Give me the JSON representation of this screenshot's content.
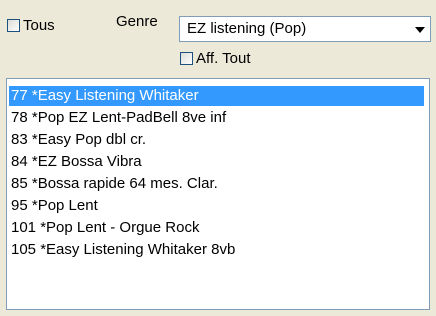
{
  "filter": {
    "tous_label": "Tous",
    "tous_checked": false,
    "genre_label": "Genre",
    "genre_value": "EZ listening (Pop)",
    "aff_tout_label": "Aff. Tout",
    "aff_tout_checked": false
  },
  "styles": {
    "selected_index": 0,
    "items": [
      "77 *Easy Listening Whitaker",
      "78 *Pop EZ Lent-PadBell 8ve inf",
      "83 *Easy Pop dbl cr.",
      "84 *EZ Bossa Vibra",
      "85 *Bossa rapide 64 mes. Clar.",
      "95 *Pop Lent",
      "101 *Pop Lent - Orgue Rock",
      "105 *Easy Listening Whitaker 8vb"
    ]
  },
  "colors": {
    "selection": "#3399ff",
    "panel": "#ece9d8",
    "border": "#7f9db9"
  }
}
